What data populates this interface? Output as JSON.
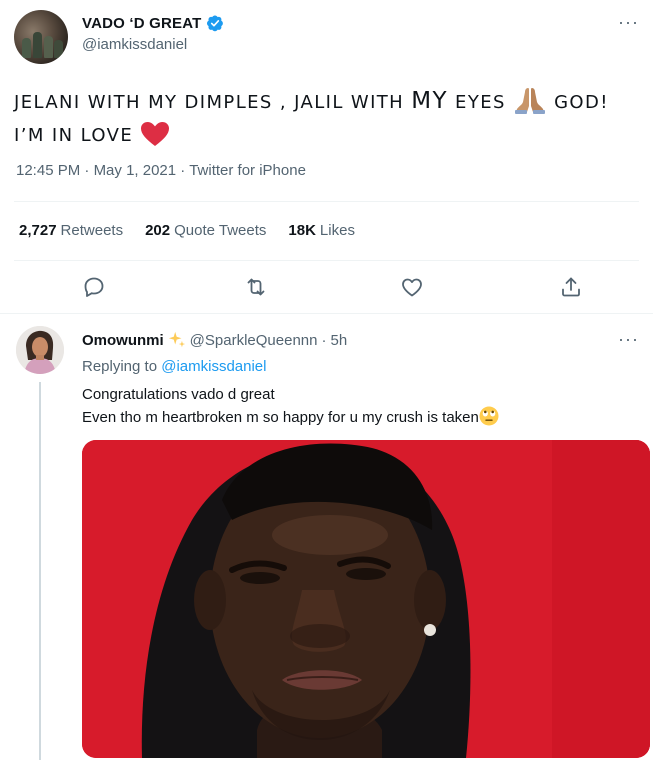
{
  "tweet": {
    "author_name": "VADO ‘D GREAT",
    "author_handle": "@iamkissdaniel",
    "more_label": "···",
    "text_part1": "JELANI WITH MY DIMPLES , JALIL WITH ",
    "text_big": "MY",
    "text_part2": " EYES ",
    "text_part3": " GOD! I’M IN LOVE ",
    "time": "12:45 PM",
    "date": "May 1, 2021",
    "source": "Twitter for iPhone",
    "separator": " · "
  },
  "stats": {
    "retweets_count": "2,727",
    "retweets_label": "Retweets",
    "quotes_count": "202",
    "quotes_label": "Quote Tweets",
    "likes_count": "18K",
    "likes_label": "Likes"
  },
  "actions": [
    "reply-icon",
    "retweet-icon",
    "like-icon",
    "share-icon"
  ],
  "reply": {
    "name": "Omowunmi",
    "handle": "@SparkleQueennn",
    "dot": "·",
    "time": "5h",
    "more_label": "···",
    "replying_prefix": "Replying to ",
    "replying_to": "@iamkissdaniel",
    "line1": "Congratulations vado d great",
    "line2": "Even tho m heartbroken m so happy for u my crush is taken"
  },
  "colors": {
    "accent": "#1d9bf0",
    "secondary_text": "#536471",
    "primary_text": "#0f1419",
    "heart": "#e0245e",
    "media_bg": "#d61a2a"
  }
}
